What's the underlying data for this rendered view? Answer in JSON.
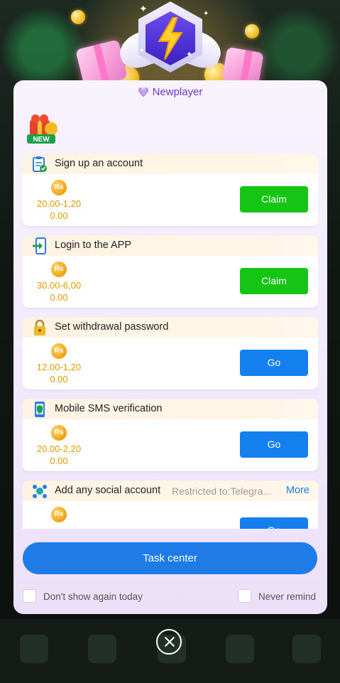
{
  "dialog": {
    "title": "Newplayer",
    "new_badge": "NEW"
  },
  "tasks": [
    {
      "title": "Sign up an account",
      "currency": "Rs",
      "range": "20.00-1,20",
      "amount": "0.00",
      "button": "Claim",
      "button_color": "#14c514",
      "icon": "clipboard-check-icon"
    },
    {
      "title": "Login to the APP",
      "currency": "Rs",
      "range": "30.00-6,00",
      "amount": "0.00",
      "button": "Claim",
      "button_color": "#14c514",
      "icon": "phone-login-icon"
    },
    {
      "title": "Set withdrawal password",
      "currency": "Rs",
      "range": "12.00-1,20",
      "amount": "0.00",
      "button": "Go",
      "button_color": "#1480f0",
      "icon": "padlock-icon"
    },
    {
      "title": "Mobile SMS verification",
      "currency": "Rs",
      "range": "20.00-2,20",
      "amount": "0.00",
      "button": "Go",
      "button_color": "#1480f0",
      "icon": "phone-shield-icon"
    },
    {
      "title": "Add any social account",
      "restriction": "Restricted to:Telegra...",
      "more": "More",
      "currency": "Rs",
      "button": "Go",
      "button_color": "#1480f0",
      "icon": "social-account-icon"
    }
  ],
  "footer": {
    "task_center": "Task center",
    "dont_show_today": "Don't show again today",
    "never_remind": "Never remind"
  },
  "colors": {
    "accent": "#1f7be6",
    "claim": "#14c514",
    "reward": "#e39a00",
    "title": "#6d35c8"
  }
}
